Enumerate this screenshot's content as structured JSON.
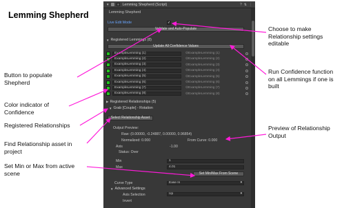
{
  "page_title": "Lemming Shepherd",
  "annotations": {
    "left": [
      {
        "text": "Button to populate\nShepherd"
      },
      {
        "text": "Color indicator of\nConfidence"
      },
      {
        "text": "Registered Relationships"
      },
      {
        "text": "Find Relationship asset in\nproject"
      },
      {
        "text": "Set Min or Max from active\nscene"
      }
    ],
    "right": [
      {
        "text": "Choose to make\nRelationship settings\neditable"
      },
      {
        "text": "Run Confidence function\non all Lemmings if one is\nbuilt"
      },
      {
        "text": "Preview of Relationship\nOutput"
      }
    ]
  },
  "inspector": {
    "header_title": "Lemming Shepherd (Script)",
    "component_name": "Lemming Shepherd",
    "live_edit_label": "Live Edit Mode",
    "live_edit_checked": true,
    "validate_button": "Validate and Auto-Populate",
    "registered_lemmings_label": "Registered Lemmings (8)",
    "update_confidence_button": "Update All Confidence Values",
    "lemmings": [
      {
        "name": "ExampleLemming (1)",
        "ref": "ExampleLemming (1)"
      },
      {
        "name": "ExampleLemming (2)",
        "ref": "ExampleLemming (2)"
      },
      {
        "name": "ExampleLemming (3)",
        "ref": "ExampleLemming (3)"
      },
      {
        "name": "ExampleLemming (4)",
        "ref": "ExampleLemming (4)"
      },
      {
        "name": "ExampleLemming (5)",
        "ref": "ExampleLemming (5)"
      },
      {
        "name": "ExampleLemming (6)",
        "ref": "ExampleLemming (6)"
      },
      {
        "name": "ExampleLemming (7)",
        "ref": "ExampleLemming (7)"
      },
      {
        "name": "ExampleLemming (8)",
        "ref": "ExampleLemming (8)"
      }
    ],
    "confidence_color": "#23c41f",
    "registered_relationships_label": "Registered Relationships (5)",
    "relationship_item": "Grab [Couple] - Rotation",
    "select_relationship_button": "Select Relationship Asset",
    "output_preview_label": "Output Preview:",
    "raw_label": "Raw: (0.00000, -0.24887, 0.00000, 0.96854)",
    "normalized_label": "Normalized: 0.000",
    "from_curve_label": "From Curve: 0.000",
    "axis_label": "Axis",
    "axis_value": "-1.00",
    "status_label": "Status: Over",
    "min_label": "Min",
    "min_value": "1",
    "max_label": "Max",
    "max_value": "4.01",
    "set_minmax_button": "Set Min/Max From Scene",
    "curve_type_label": "Curve Type",
    "curve_type_value": "Ease In",
    "advanced_label": "Advanced Settings",
    "axis_selection_label": "Axis Selection",
    "axis_selection_value": "Up",
    "invert_label": "Invert"
  }
}
